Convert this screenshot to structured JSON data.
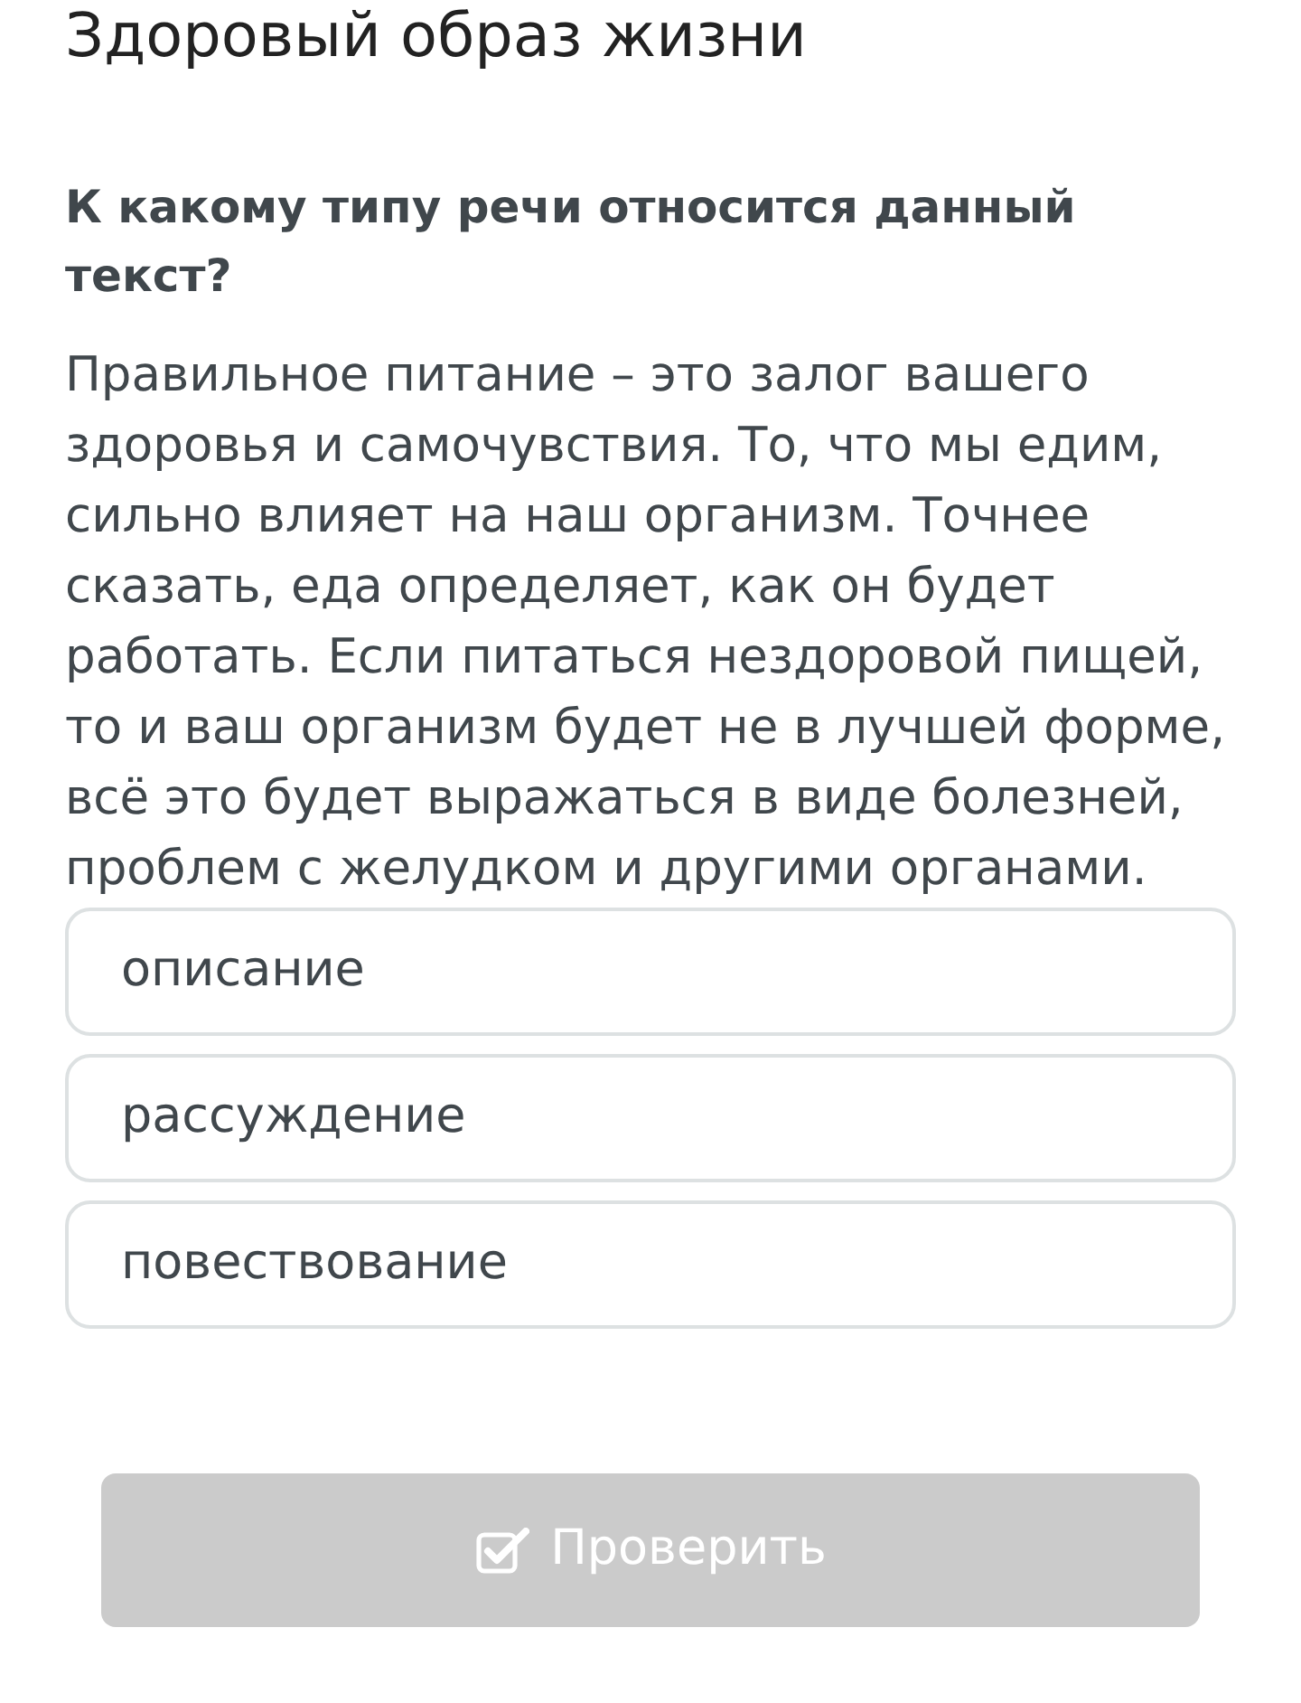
{
  "lesson": {
    "title": "Здоровый образ жизни"
  },
  "question": {
    "prompt": "К какому типу речи относится данный текст?",
    "text": "Правильное питание – это залог вашего здоровья и самочувствия. То, что мы едим, сильно влияет на наш организм. Точнее сказать, еда определяет, как он будет работать. Если питаться нездоровой пищей, то и ваш организм будет не в лучшей форме, всё это будет выражаться в виде болезней, проблем с желудком и другими органами."
  },
  "options": [
    {
      "label": "описание",
      "selected": false
    },
    {
      "label": "рассуждение",
      "selected": false
    },
    {
      "label": "повествование",
      "selected": false
    }
  ],
  "check_button": {
    "label": "Проверить",
    "disabled": true
  }
}
